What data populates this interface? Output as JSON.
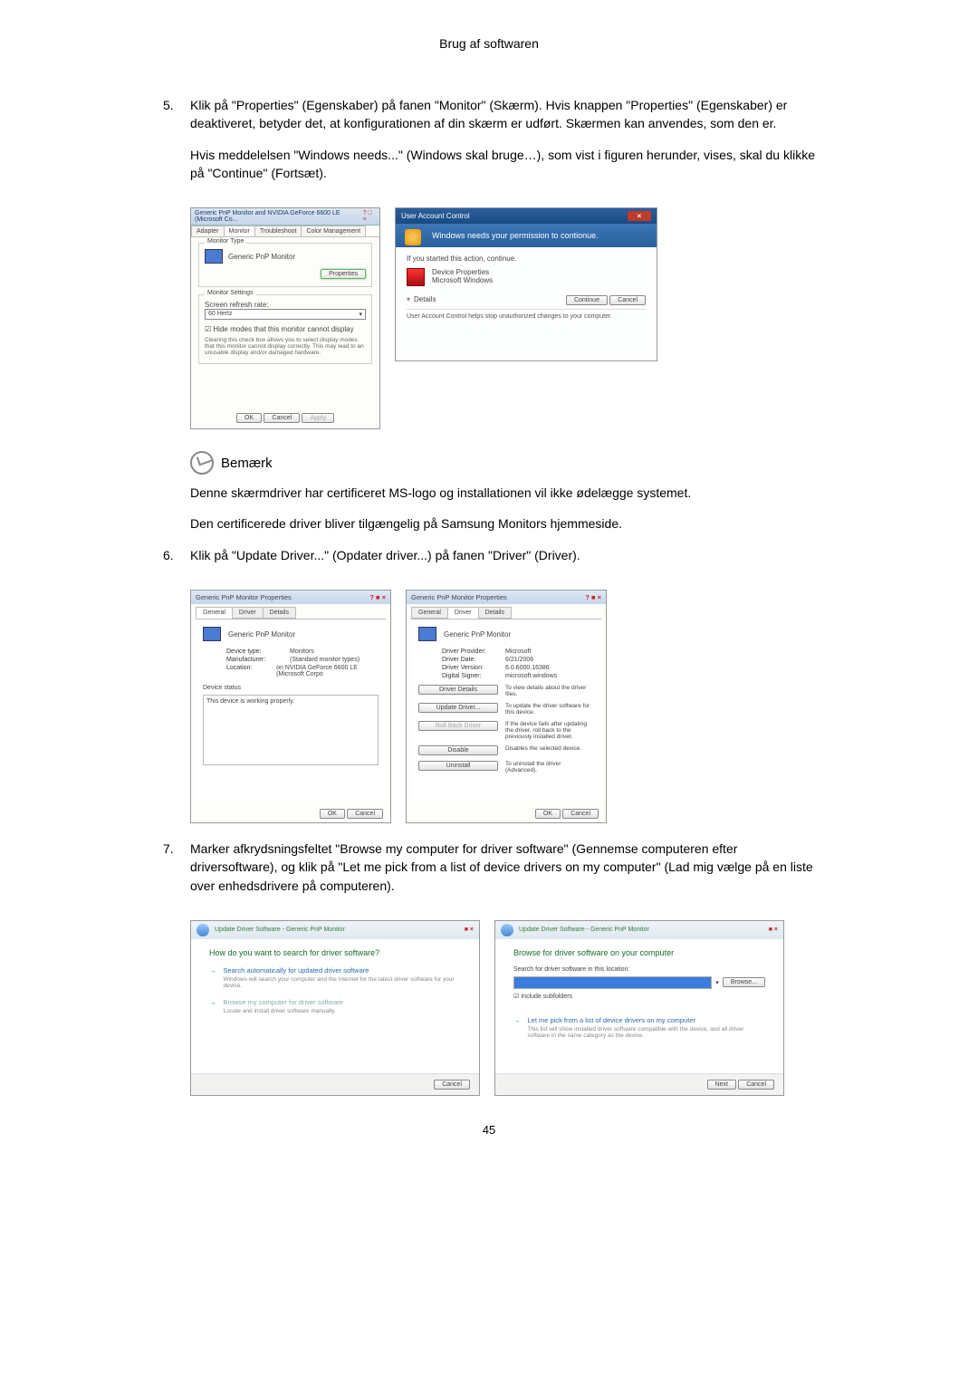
{
  "header": {
    "title": "Brug af softwaren"
  },
  "steps": {
    "s5": {
      "num": "5.",
      "p1": "Klik på \"Properties\" (Egenskaber) på fanen \"Monitor\" (Skærm). Hvis knappen \"Properties\" (Egenskaber) er deaktiveret, betyder det, at konfigurationen af din skærm er udført. Skærmen kan anvendes, som den er.",
      "p2": "Hvis meddelelsen \"Windows needs...\" (Windows skal bruge…), som vist i figuren herunder, vises, skal du klikke på \"Continue\" (Fortsæt)."
    },
    "s6": {
      "num": "6.",
      "p1": "Klik på \"Update Driver...\" (Opdater driver...) på fanen \"Driver\" (Driver)."
    },
    "s7": {
      "num": "7.",
      "p1": "Marker afkrydsningsfeltet \"Browse my computer for driver software\" (Gennemse computeren efter driversoftware), og klik på \"Let me pick from a list of device drivers on my computer\" (Lad mig vælge på en liste over enhedsdrivere på computeren)."
    }
  },
  "note": {
    "label": "Bemærk",
    "p1": "Denne skærmdriver har certificeret MS-logo og installationen vil ikke ødelægge systemet.",
    "p2": "Den certificerede driver bliver tilgængelig på Samsung Monitors hjemmeside."
  },
  "fig1": {
    "title": "Generic PnP Monitor and NVIDIA GeForce 6600 LE (Microsoft Co...",
    "tabs": {
      "a": "Adapter",
      "b": "Monitor",
      "c": "Troubleshoot",
      "d": "Color Management"
    },
    "monitorType": {
      "legend": "Monitor Type",
      "name": "Generic PnP Monitor",
      "properties": "Properties"
    },
    "settings": {
      "legend": "Monitor Settings",
      "refresh_label": "Screen refresh rate:",
      "refresh_value": "60 Hertz",
      "hide": "Hide modes that this monitor cannot display",
      "note": "Clearing this check box allows you to select display modes that this monitor cannot display correctly. This may lead to an unusable display and/or damaged hardware."
    },
    "buttons": {
      "ok": "OK",
      "cancel": "Cancel",
      "apply": "Apply"
    }
  },
  "fig2": {
    "title": "User Account Control",
    "band": "Windows needs your permission to contionue.",
    "started": "If you started this action, continue.",
    "app": "Device Properties",
    "publisher": "Microsoft Windows",
    "details": "Details",
    "continue": "Continue",
    "cancel": "Cancel",
    "footer": "User Account Control helps stop unauthorized changes to your computer."
  },
  "driverProps": {
    "title": "Generic PnP Monitor Properties",
    "tabs": {
      "general": "General",
      "driver": "Driver",
      "details": "Details"
    },
    "name": "Generic PnP Monitor",
    "general": {
      "deviceType_k": "Device type:",
      "deviceType_v": "Monitors",
      "manufacturer_k": "Manufacturer:",
      "manufacturer_v": "(Standard monitor types)",
      "location_k": "Location:",
      "location_v": "on NVIDIA GeForce 6600 LE (Microsoft Corpo",
      "status_legend": "Device status",
      "status_text": "This device is working properly."
    },
    "driver": {
      "provider_k": "Driver Provider:",
      "provider_v": "Microsoft",
      "date_k": "Driver Date:",
      "date_v": "6/21/2006",
      "version_k": "Driver Version:",
      "version_v": "6.0.6000.16386",
      "signer_k": "Digital Signer:",
      "signer_v": "microsoft windows",
      "btn_details": "Driver Details",
      "desc_details": "To view details about the driver files.",
      "btn_update": "Update Driver...",
      "desc_update": "To update the driver software for this device.",
      "btn_rollback": "Roll Back Driver",
      "desc_rollback": "If the device fails after updating the driver, roll back to the previously installed driver.",
      "btn_disable": "Disable",
      "desc_disable": "Disables the selected device.",
      "btn_uninstall": "Uninstall",
      "desc_uninstall": "To uninstall the driver (Advanced)."
    },
    "ok": "OK",
    "cancel": "Cancel"
  },
  "wizard": {
    "crumb": "Update Driver Software - Generic PnP Monitor",
    "left": {
      "heading": "How do you want to search for driver software?",
      "opt1_t": "Search automatically for updated driver software",
      "opt1_s": "Windows will search your computer and the Internet for the latest driver software for your device.",
      "opt2_t": "Browse my computer for driver software",
      "opt2_s": "Locate and install driver software manually.",
      "cancel": "Cancel"
    },
    "right": {
      "heading": "Browse for driver software on your computer",
      "search_label": "Search for driver software in this location:",
      "path": "",
      "browse": "Browse...",
      "include": "Include subfolders",
      "opt_t": "Let me pick from a list of device drivers on my computer",
      "opt_s": "This list will show installed driver software compatible with the device, and all driver software in the same category as the device.",
      "next": "Next",
      "cancel": "Cancel"
    }
  },
  "pageNumber": "45"
}
